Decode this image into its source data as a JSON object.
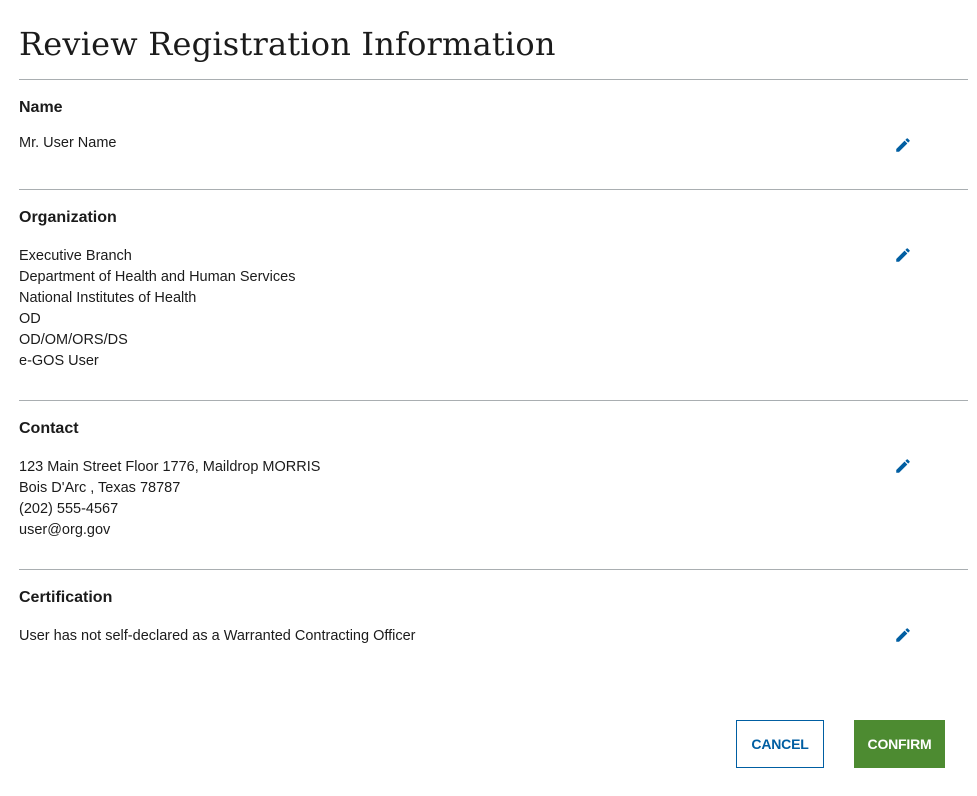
{
  "page": {
    "title": "Review Registration Information"
  },
  "colors": {
    "accent": "#005ea2",
    "confirm": "#4d8b31",
    "divider": "#a9aeb1",
    "text": "#1b1b1b"
  },
  "sections": {
    "name": {
      "heading": "Name",
      "lines": [
        "Mr. User Name"
      ],
      "edit_icon": "pencil-icon"
    },
    "organization": {
      "heading": "Organization",
      "lines": [
        "Executive Branch",
        "Department of Health and Human Services",
        "National Institutes of Health",
        "OD",
        "OD/OM/ORS/DS",
        "e-GOS User"
      ],
      "edit_icon": "pencil-icon"
    },
    "contact": {
      "heading": "Contact",
      "lines": [
        "123 Main Street Floor 1776, Maildrop MORRIS",
        "Bois D'Arc , Texas 78787",
        "(202) 555-4567",
        "user@org.gov"
      ],
      "edit_icon": "pencil-icon"
    },
    "certification": {
      "heading": "Certification",
      "lines": [
        "User has not self-declared as a Warranted Contracting Officer"
      ],
      "edit_icon": "pencil-icon"
    }
  },
  "actions": {
    "cancel_label": "CANCEL",
    "confirm_label": "CONFIRM"
  }
}
